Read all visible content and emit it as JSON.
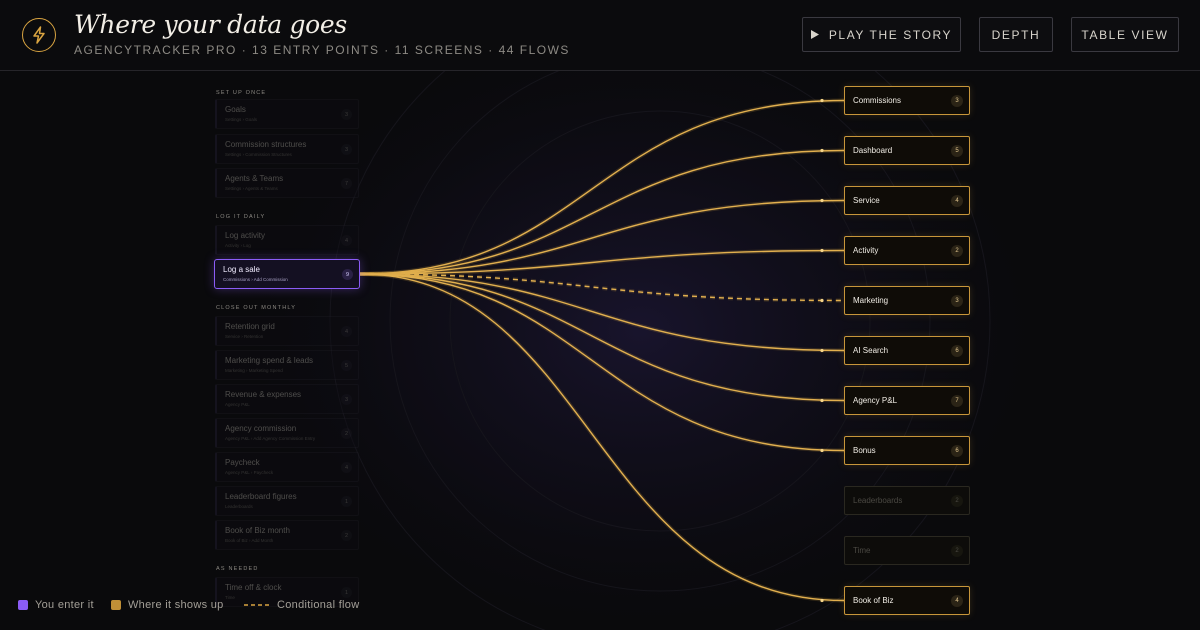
{
  "header": {
    "title": "Where your data goes",
    "subtitle": "AGENCYTRACKER PRO · 13 ENTRY POINTS · 11 SCREENS · 44 FLOWS",
    "logo_icon": "lightning-bolt-icon",
    "buttons": {
      "play": "PLAY THE STORY",
      "depth": "DEPTH",
      "table": "TABLE VIEW"
    }
  },
  "colors": {
    "accent_gold": "#d9a441",
    "accent_purple": "#8b5cf6",
    "background": "#0a0a0c"
  },
  "sources": {
    "groups": [
      {
        "label": "SET UP ONCE",
        "items": [
          {
            "name": "Goals",
            "path": "Settings › Goals",
            "count": "3"
          },
          {
            "name": "Commission structures",
            "path": "Settings › Commission Structures",
            "count": "3"
          },
          {
            "name": "Agents & Teams",
            "path": "Settings › Agents & Teams",
            "count": "7"
          }
        ]
      },
      {
        "label": "LOG IT DAILY",
        "items": [
          {
            "name": "Log activity",
            "path": "Activity › Log",
            "count": "4"
          },
          {
            "name": "Log a sale",
            "path": "Commissions › Add Commission",
            "count": "9",
            "active": true
          }
        ]
      },
      {
        "label": "CLOSE OUT MONTHLY",
        "items": [
          {
            "name": "Retention grid",
            "path": "Service › Retention",
            "count": "4"
          },
          {
            "name": "Marketing spend & leads",
            "path": "Marketing › Marketing Spend",
            "count": "5"
          },
          {
            "name": "Revenue & expenses",
            "path": "Agency P&L",
            "count": "3"
          },
          {
            "name": "Agency commission",
            "path": "Agency P&L › Add Agency Commission Entry",
            "count": "2"
          },
          {
            "name": "Paycheck",
            "path": "Agency P&L › Paycheck",
            "count": "4"
          },
          {
            "name": "Leaderboard figures",
            "path": "Leaderboards",
            "count": "1"
          },
          {
            "name": "Book of Biz month",
            "path": "Book of Biz › Add Month",
            "count": "2"
          }
        ]
      },
      {
        "label": "AS NEEDED",
        "items": [
          {
            "name": "Time off & clock",
            "path": "Time",
            "count": "1"
          }
        ]
      }
    ]
  },
  "destinations": [
    {
      "name": "Commissions",
      "count": "3",
      "active": true
    },
    {
      "name": "Dashboard",
      "count": "5",
      "active": true
    },
    {
      "name": "Service",
      "count": "4",
      "active": true
    },
    {
      "name": "Activity",
      "count": "2",
      "active": true
    },
    {
      "name": "Marketing",
      "count": "3",
      "active": true,
      "conditional": true
    },
    {
      "name": "AI Search",
      "count": "6",
      "active": true
    },
    {
      "name": "Agency P&L",
      "count": "7",
      "active": true
    },
    {
      "name": "Bonus",
      "count": "6",
      "active": true
    },
    {
      "name": "Leaderboards",
      "count": "2",
      "active": false
    },
    {
      "name": "Time",
      "count": "2",
      "active": false
    },
    {
      "name": "Book of Biz",
      "count": "4",
      "active": true
    }
  ],
  "legend": {
    "enter": "You enter it",
    "shows": "Where it shows up",
    "conditional": "Conditional flow"
  }
}
